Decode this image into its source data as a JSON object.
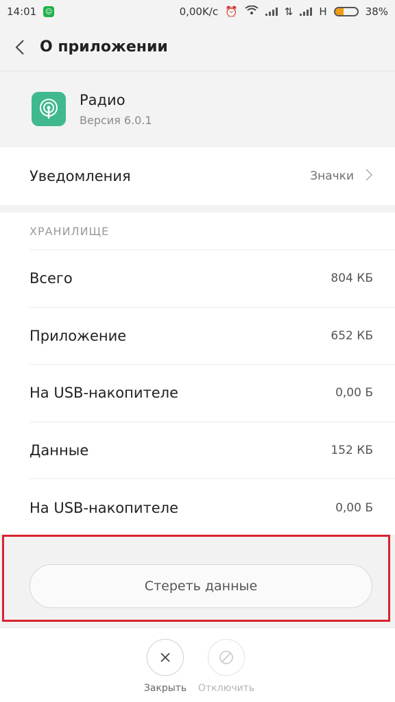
{
  "status": {
    "time": "14:01",
    "speed": "0,00K/c",
    "network": "H",
    "battery": "38%",
    "battery_level": 0.38
  },
  "topbar": {
    "title": "О приложении"
  },
  "app": {
    "name": "Радио",
    "version": "Версия 6.0.1"
  },
  "notifications": {
    "label": "Уведомления",
    "value": "Значки"
  },
  "storage": {
    "title": "ХРАНИЛИЩЕ",
    "rows": [
      {
        "label": "Всего",
        "value": "804 КБ"
      },
      {
        "label": "Приложение",
        "value": "652 КБ"
      },
      {
        "label": "На USB-накопителе",
        "value": "0,00 Б"
      },
      {
        "label": "Данные",
        "value": "152 КБ"
      },
      {
        "label": "На USB-накопителе",
        "value": "0,00 Б"
      }
    ]
  },
  "clear_button": "Стереть данные",
  "actions": {
    "close": "Закрыть",
    "disable": "Отключить"
  }
}
